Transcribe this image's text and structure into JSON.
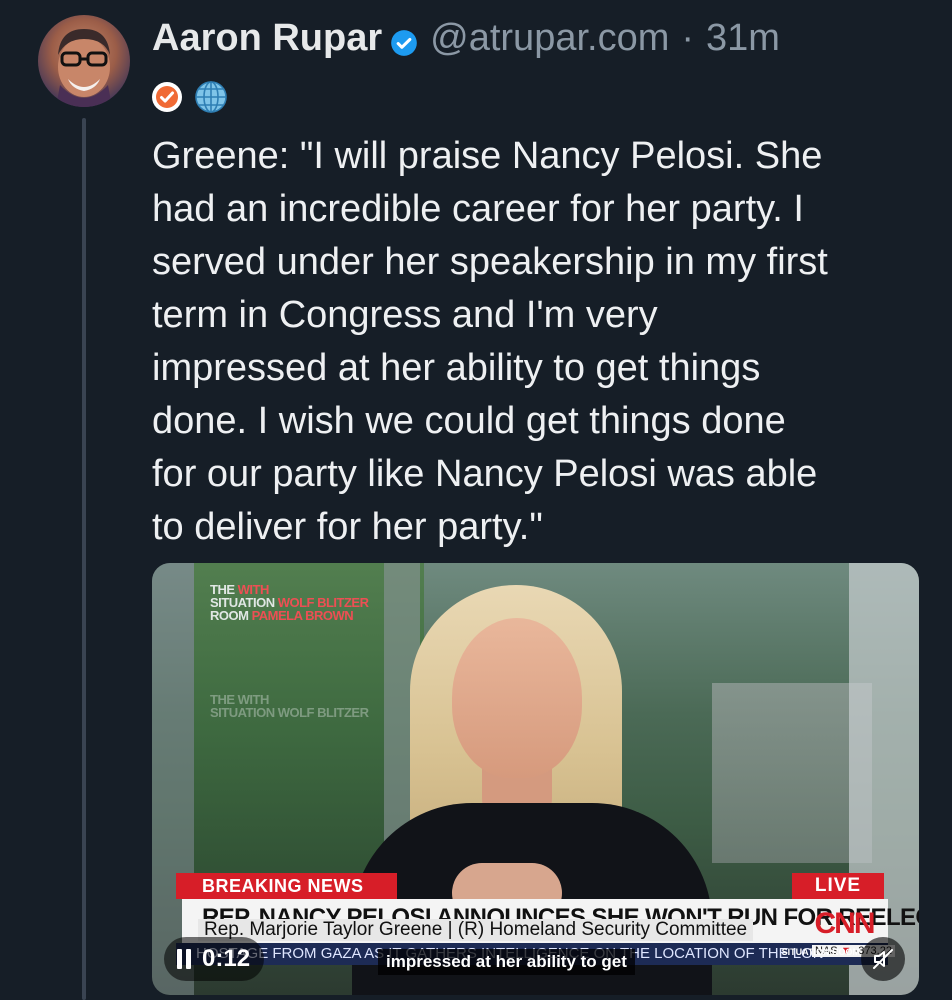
{
  "post": {
    "author_name": "Aaron Rupar",
    "handle": "@atrupar.com",
    "separator": "·",
    "timestamp": "31m",
    "text": "Greene: \"I will praise Nancy Pelosi. She\nhad an incredible career for her party. I\nserved under her speakership in my first\nterm in Congress and I'm very\nimpressed at her ability to get things\ndone. I wish we could get things done\nfor our party like Nancy Pelosi was able\nto deliver for her party.\""
  },
  "video": {
    "watermark": {
      "line1": "THE",
      "line1b": "WITH",
      "line2": "SITUATION",
      "line2b": "WOLF BLITZER",
      "line3": "ROOM",
      "line3b": "PAMELA BROWN"
    },
    "breaking_label": "BREAKING NEWS",
    "live_label": "LIVE",
    "headline": "REP. NANCY PELOSI ANNOUNCES SHE WON'T RUN FOR REELECTION",
    "subline": "Rep. Marjorie Taylor Greene  |  (R) Homeland Security Committee",
    "network_logo": "CNN",
    "ticker": "HOSTAGE FROM GAZA AS IT GATHERS INTELLIGENCE ON THE LOCATION OF THE LON",
    "market_label": "NAS",
    "market_value": "-373.22",
    "program_tag": "SITUATION ROOM",
    "caption": "impressed at her ability to get",
    "elapsed_time": "0:12"
  },
  "colors": {
    "background": "#161e27",
    "verified_blue": "#1d9bf0",
    "cnn_red": "#d71e28"
  },
  "icons": [
    "verified-check-icon",
    "badge-check-icon",
    "globe-icon",
    "pause-icon",
    "mute-icon"
  ]
}
